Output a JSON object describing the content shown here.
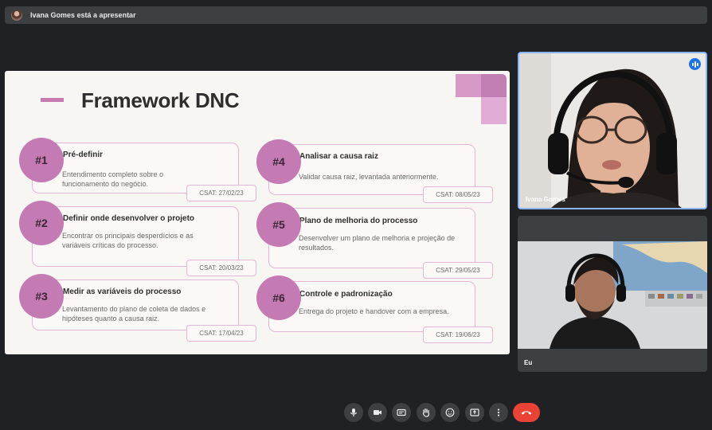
{
  "presenter_bar": {
    "text": "Ivana Gomes está a apresentar"
  },
  "slide": {
    "title": "Framework DNC",
    "steps": [
      {
        "num": "#1",
        "title": "Pré-definir",
        "desc": "Entendimento completo sobre o funcionamento do negócio.",
        "csat": "CSAT: 27/02/23"
      },
      {
        "num": "#2",
        "title": "Definir onde desenvolver o projeto",
        "desc": "Encontrar os principais desperdícios e as variáveis críticas do processo.",
        "csat": "CSAT: 20/03/23"
      },
      {
        "num": "#3",
        "title": "Medir as variáveis do processo",
        "desc": "Levantamento do plano de coleta de dados e hipóteses quanto a causa raiz.",
        "csat": "CSAT: 17/04/23"
      },
      {
        "num": "#4",
        "title": "Analisar a causa raiz",
        "desc": "Validar causa raiz, levantada anteriormente.",
        "csat": "CSAT: 08/05/23"
      },
      {
        "num": "#5",
        "title": "Plano de melhoria do processo",
        "desc": "Desenvolver um plano de melhoria e projeção de resultados.",
        "csat": "CSAT: 29/05/23"
      },
      {
        "num": "#6",
        "title": "Controle e padronização",
        "desc": "Entrega do projeto e handover com a empresa.",
        "csat": "CSAT: 19/06/23"
      }
    ]
  },
  "participants": [
    {
      "name": "Ivana Gomes",
      "speaking": true
    },
    {
      "name": "Eu",
      "speaking": false
    }
  ],
  "controls": [
    {
      "id": "mic",
      "icon": "microphone-icon"
    },
    {
      "id": "camera",
      "icon": "camera-icon"
    },
    {
      "id": "captions",
      "icon": "captions-icon"
    },
    {
      "id": "raise-hand",
      "icon": "hand-icon"
    },
    {
      "id": "reactions",
      "icon": "emoji-icon"
    },
    {
      "id": "present",
      "icon": "present-screen-icon"
    },
    {
      "id": "more",
      "icon": "more-vertical-icon"
    },
    {
      "id": "leave",
      "icon": "end-call-icon"
    }
  ],
  "colors": {
    "accent": "#c47ab2",
    "end_call": "#ea4335",
    "speaking": "#1a73e8"
  }
}
